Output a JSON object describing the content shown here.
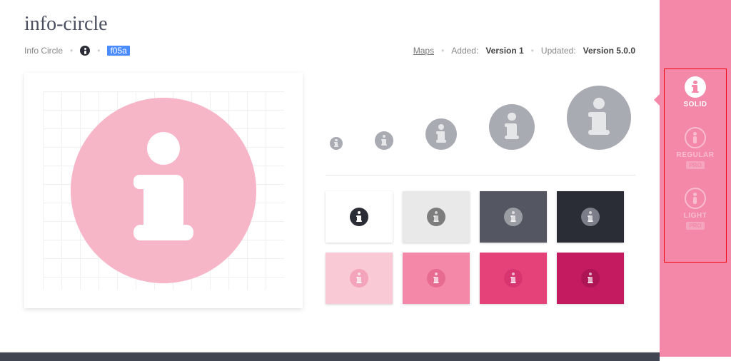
{
  "header": {
    "title": "info-circle",
    "display_name": "Info Circle",
    "unicode": "f05a",
    "category": "Maps",
    "added_label": "Added:",
    "added_value": "Version 1",
    "updated_label": "Updated:",
    "updated_value": "Version 5.0.0"
  },
  "preview": {
    "icon_color": "#f7b6c7",
    "glyph_color": "#ffffff",
    "size": 260
  },
  "sizes": [
    18,
    26,
    44,
    64,
    90
  ],
  "swatches": [
    {
      "bg": "#ffffff",
      "fg": "#2b2d36"
    },
    {
      "bg": "#e9e9e9",
      "fg": "#7d7d7d"
    },
    {
      "bg": "#545761",
      "fg": "#9a9ca3"
    },
    {
      "bg": "#2b2d36",
      "fg": "#7b7e88"
    },
    {
      "bg": "#f9c9d6",
      "fg": "#f4a4ba"
    },
    {
      "bg": "#f388a9",
      "fg": "#e86b92"
    },
    {
      "bg": "#e6427a",
      "fg": "#d83570"
    },
    {
      "bg": "#c31a60",
      "fg": "#ad1555"
    }
  ],
  "styles": [
    {
      "id": "solid",
      "label": "SOLID",
      "pro": false,
      "active": true
    },
    {
      "id": "regular",
      "label": "REGULAR",
      "pro": true,
      "active": false
    },
    {
      "id": "light",
      "label": "LIGHT",
      "pro": true,
      "active": false
    }
  ],
  "pro_label": "PRO",
  "side_color": "#f388a9"
}
